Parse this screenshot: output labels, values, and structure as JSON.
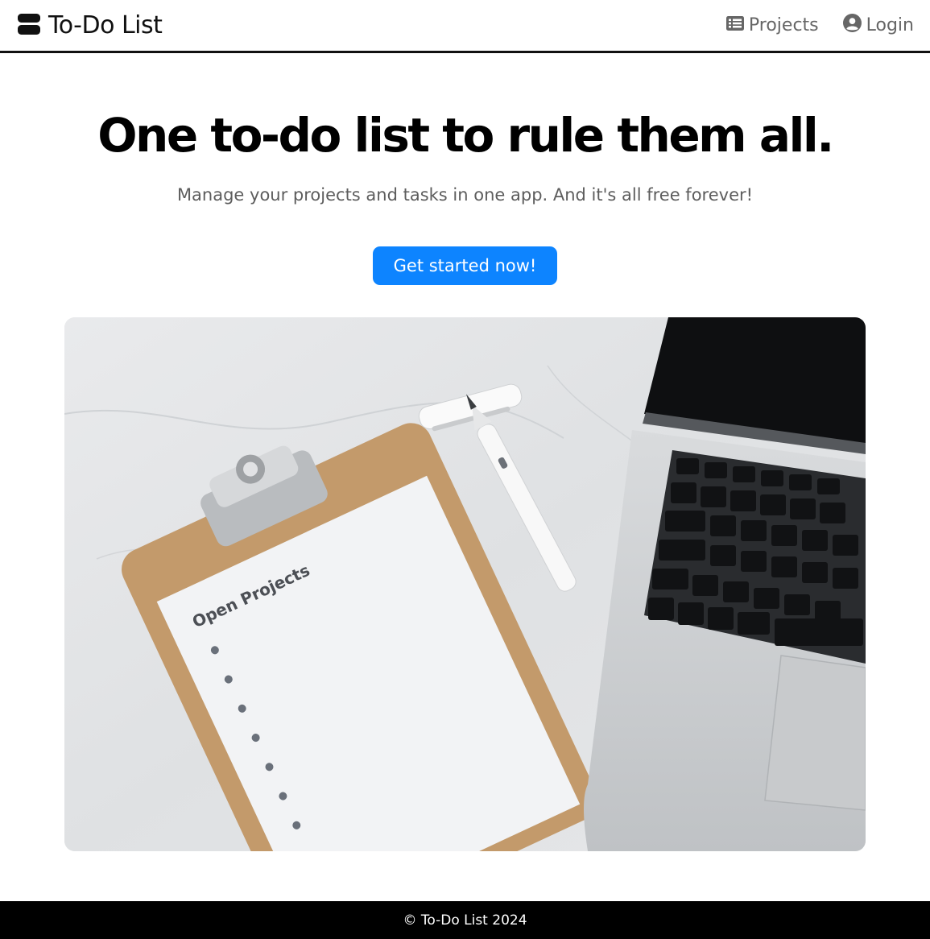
{
  "navbar": {
    "brand": "To-Do List",
    "brand_icon": "server-icon",
    "links": [
      {
        "label": "Projects",
        "icon": "list-alt-icon"
      },
      {
        "label": "Login",
        "icon": "user-circle-icon"
      }
    ]
  },
  "hero": {
    "title": "One to-do list to rule them all.",
    "subtitle": "Manage your projects and tasks in one app. And it's all free forever!",
    "cta_label": "Get started now!",
    "clipboard_heading": "Open Projects"
  },
  "footer": {
    "text": "© To-Do List 2024"
  },
  "colors": {
    "accent": "#0d84ff",
    "text": "#000000",
    "muted": "#5d5d5d",
    "footer_bg": "#000000"
  }
}
